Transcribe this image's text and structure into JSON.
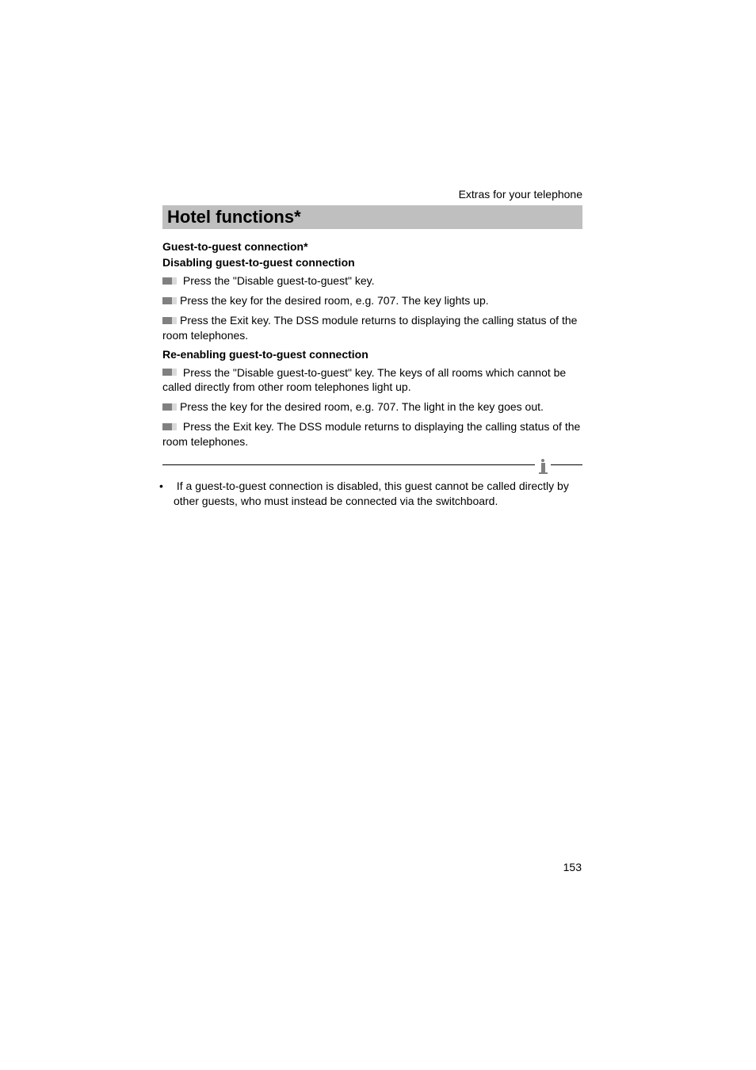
{
  "header": {
    "section_label": "Extras for your telephone"
  },
  "title": "Hotel functions*",
  "sections": {
    "sub1": "Guest-to-guest connection*",
    "sub2": "Disabling guest-to-guest connection",
    "a1": " Press the \"Disable guest-to-guest\" key.",
    "a2": "Press the key for the desired room, e.g. 707. The key lights up.",
    "a3": "Press the Exit key. The DSS module returns to displaying the calling status of the room telephones.",
    "sub3": "Re-enabling guest-to-guest connection",
    "a4": " Press the \"Disable guest-to-guest\" key. The keys of all rooms which cannot be called directly from other room telephones light up.",
    "a5": "Press the key for the desired room, e.g. 707. The light in the key goes out.",
    "a6": " Press the Exit key. The DSS module returns to displaying the calling status of the room telephones."
  },
  "note": "If a guest-to-guest connection is disabled, this guest cannot be called directly by other guests, who must instead be connected via the switchboard.",
  "page_number": "153"
}
